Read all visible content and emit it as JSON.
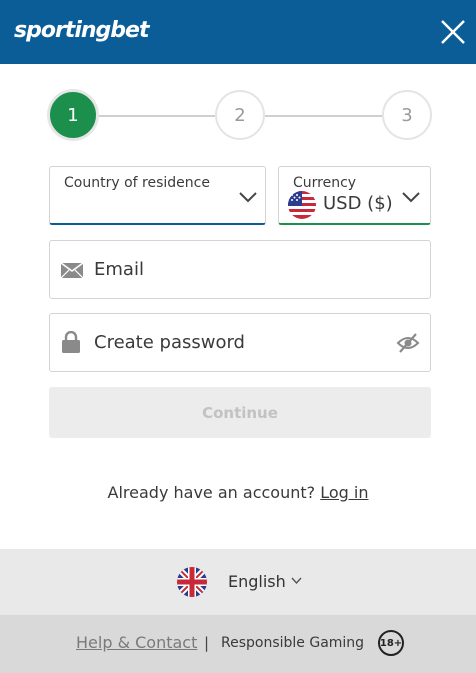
{
  "header": {
    "logo_main": "sporting",
    "logo_accent": "bet",
    "close_icon": "close-icon",
    "background_color": "#0b5d98"
  },
  "stepper": {
    "steps": [
      "1",
      "2",
      "3"
    ],
    "active_step": "1",
    "active_color": "#1c8f4d"
  },
  "form": {
    "country": {
      "label": "Country of residence",
      "value": ""
    },
    "currency": {
      "label": "Currency",
      "value": "USD ($)",
      "flag_icon": "us-flag-icon"
    },
    "email": {
      "placeholder": "Email",
      "icon": "envelope-icon"
    },
    "password": {
      "placeholder": "Create password",
      "icon": "lock-icon",
      "toggle_icon": "eye-off-icon"
    },
    "continue_label": "Continue"
  },
  "login": {
    "prompt": "Already have an account?",
    "link_label": "Log in"
  },
  "language": {
    "selected": "English",
    "flag_icon": "uk-flag-icon"
  },
  "footer": {
    "help_label": "Help & Contact",
    "separator": "|",
    "responsible_label": "Responsible Gaming",
    "age_badge": "18+"
  }
}
